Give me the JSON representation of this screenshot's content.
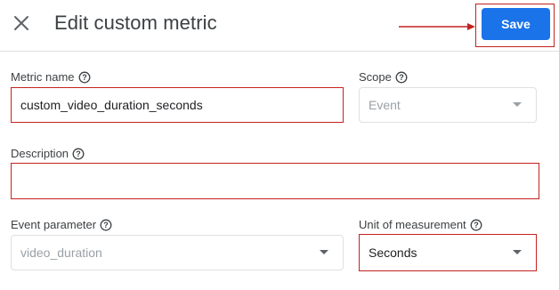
{
  "header": {
    "title": "Edit custom metric",
    "save_label": "Save"
  },
  "form": {
    "metric_name": {
      "label": "Metric name",
      "value": "custom_video_duration_seconds"
    },
    "scope": {
      "label": "Scope",
      "value": "Event"
    },
    "description": {
      "label": "Description",
      "value": ""
    },
    "event_parameter": {
      "label": "Event parameter",
      "value": "video_duration"
    },
    "unit_of_measurement": {
      "label": "Unit of measurement",
      "value": "Seconds"
    }
  },
  "colors": {
    "accent": "#1a73e8",
    "annotation": "#c5221f"
  }
}
